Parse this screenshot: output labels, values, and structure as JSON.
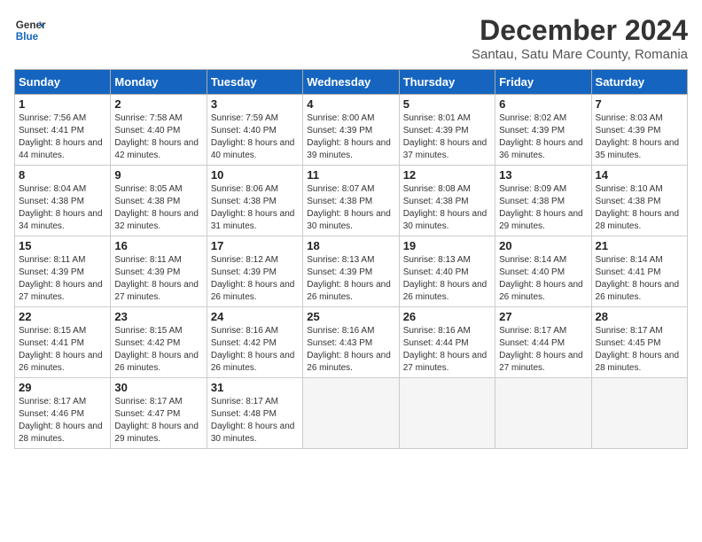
{
  "logo": {
    "line1": "General",
    "line2": "Blue"
  },
  "title": "December 2024",
  "location": "Santau, Satu Mare County, Romania",
  "days_of_week": [
    "Sunday",
    "Monday",
    "Tuesday",
    "Wednesday",
    "Thursday",
    "Friday",
    "Saturday"
  ],
  "weeks": [
    [
      {
        "day": 1,
        "sunrise": "7:56 AM",
        "sunset": "4:41 PM",
        "daylight": "8 hours and 44 minutes."
      },
      {
        "day": 2,
        "sunrise": "7:58 AM",
        "sunset": "4:40 PM",
        "daylight": "8 hours and 42 minutes."
      },
      {
        "day": 3,
        "sunrise": "7:59 AM",
        "sunset": "4:40 PM",
        "daylight": "8 hours and 40 minutes."
      },
      {
        "day": 4,
        "sunrise": "8:00 AM",
        "sunset": "4:39 PM",
        "daylight": "8 hours and 39 minutes."
      },
      {
        "day": 5,
        "sunrise": "8:01 AM",
        "sunset": "4:39 PM",
        "daylight": "8 hours and 37 minutes."
      },
      {
        "day": 6,
        "sunrise": "8:02 AM",
        "sunset": "4:39 PM",
        "daylight": "8 hours and 36 minutes."
      },
      {
        "day": 7,
        "sunrise": "8:03 AM",
        "sunset": "4:39 PM",
        "daylight": "8 hours and 35 minutes."
      }
    ],
    [
      {
        "day": 8,
        "sunrise": "8:04 AM",
        "sunset": "4:38 PM",
        "daylight": "8 hours and 34 minutes."
      },
      {
        "day": 9,
        "sunrise": "8:05 AM",
        "sunset": "4:38 PM",
        "daylight": "8 hours and 32 minutes."
      },
      {
        "day": 10,
        "sunrise": "8:06 AM",
        "sunset": "4:38 PM",
        "daylight": "8 hours and 31 minutes."
      },
      {
        "day": 11,
        "sunrise": "8:07 AM",
        "sunset": "4:38 PM",
        "daylight": "8 hours and 30 minutes."
      },
      {
        "day": 12,
        "sunrise": "8:08 AM",
        "sunset": "4:38 PM",
        "daylight": "8 hours and 30 minutes."
      },
      {
        "day": 13,
        "sunrise": "8:09 AM",
        "sunset": "4:38 PM",
        "daylight": "8 hours and 29 minutes."
      },
      {
        "day": 14,
        "sunrise": "8:10 AM",
        "sunset": "4:38 PM",
        "daylight": "8 hours and 28 minutes."
      }
    ],
    [
      {
        "day": 15,
        "sunrise": "8:11 AM",
        "sunset": "4:39 PM",
        "daylight": "8 hours and 27 minutes."
      },
      {
        "day": 16,
        "sunrise": "8:11 AM",
        "sunset": "4:39 PM",
        "daylight": "8 hours and 27 minutes."
      },
      {
        "day": 17,
        "sunrise": "8:12 AM",
        "sunset": "4:39 PM",
        "daylight": "8 hours and 26 minutes."
      },
      {
        "day": 18,
        "sunrise": "8:13 AM",
        "sunset": "4:39 PM",
        "daylight": "8 hours and 26 minutes."
      },
      {
        "day": 19,
        "sunrise": "8:13 AM",
        "sunset": "4:40 PM",
        "daylight": "8 hours and 26 minutes."
      },
      {
        "day": 20,
        "sunrise": "8:14 AM",
        "sunset": "4:40 PM",
        "daylight": "8 hours and 26 minutes."
      },
      {
        "day": 21,
        "sunrise": "8:14 AM",
        "sunset": "4:41 PM",
        "daylight": "8 hours and 26 minutes."
      }
    ],
    [
      {
        "day": 22,
        "sunrise": "8:15 AM",
        "sunset": "4:41 PM",
        "daylight": "8 hours and 26 minutes."
      },
      {
        "day": 23,
        "sunrise": "8:15 AM",
        "sunset": "4:42 PM",
        "daylight": "8 hours and 26 minutes."
      },
      {
        "day": 24,
        "sunrise": "8:16 AM",
        "sunset": "4:42 PM",
        "daylight": "8 hours and 26 minutes."
      },
      {
        "day": 25,
        "sunrise": "8:16 AM",
        "sunset": "4:43 PM",
        "daylight": "8 hours and 26 minutes."
      },
      {
        "day": 26,
        "sunrise": "8:16 AM",
        "sunset": "4:44 PM",
        "daylight": "8 hours and 27 minutes."
      },
      {
        "day": 27,
        "sunrise": "8:17 AM",
        "sunset": "4:44 PM",
        "daylight": "8 hours and 27 minutes."
      },
      {
        "day": 28,
        "sunrise": "8:17 AM",
        "sunset": "4:45 PM",
        "daylight": "8 hours and 28 minutes."
      }
    ],
    [
      {
        "day": 29,
        "sunrise": "8:17 AM",
        "sunset": "4:46 PM",
        "daylight": "8 hours and 28 minutes."
      },
      {
        "day": 30,
        "sunrise": "8:17 AM",
        "sunset": "4:47 PM",
        "daylight": "8 hours and 29 minutes."
      },
      {
        "day": 31,
        "sunrise": "8:17 AM",
        "sunset": "4:48 PM",
        "daylight": "8 hours and 30 minutes."
      },
      null,
      null,
      null,
      null
    ]
  ]
}
